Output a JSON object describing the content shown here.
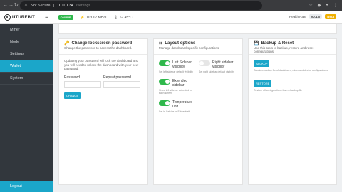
{
  "browser": {
    "security_label": "Not Secure",
    "url_host": "10.0.0.34",
    "url_path": "/settings"
  },
  "header": {
    "logo_text": "UTUREBIT",
    "status_badge": "ONLINE",
    "hashrate": "103.07 MH/s",
    "temperature": "67.45°C",
    "health_label": "Health Rate",
    "version": "v0.1.0",
    "beta_label": "Beta"
  },
  "sidebar": {
    "items": [
      {
        "label": "Miner"
      },
      {
        "label": "Node"
      },
      {
        "label": "Settings"
      },
      {
        "label": "Wallet"
      },
      {
        "label": "System"
      }
    ],
    "logout": "Logout"
  },
  "cards": {
    "password": {
      "title": "Change lockscreen password",
      "subtitle": "Change the password to access the dashboard.",
      "desc": "Updating your password will lock the dashboard and you will need to unlock the dashboard with your new password.",
      "label_password": "Password",
      "label_repeat": "Repeat password",
      "button": "CHANGE"
    },
    "layout": {
      "title": "Layout options",
      "subtitle": "Manage dashboard specific configurations",
      "opt1_title": "Left Sidebar visibility",
      "opt1_desc": "Set left sidebar default visibility",
      "opt2_title": "Right sidebar visibility",
      "opt2_desc": "Set right sidebar default visibility",
      "opt3_title": "Extended sidebar",
      "opt3_desc": "Show left sidebar extended in each screen",
      "opt4_title": "Temperature unit",
      "opt4_desc": "Set in Celsius or Fahrenheit"
    },
    "backup": {
      "title": "Backup & Reset",
      "subtitle": "Use this tools to backup, restore and reset configurations",
      "backup_button": "BACKUP",
      "backup_desc": "Create a backup file of dashboard, miner and device configurations",
      "restore_button": "RESTORE",
      "restore_desc": "Restore all configurations from a backup file"
    }
  }
}
